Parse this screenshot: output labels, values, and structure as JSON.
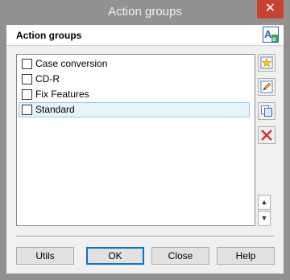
{
  "window": {
    "title": "Action groups",
    "close_glyph": "✕"
  },
  "header": {
    "label": "Action groups",
    "icon": "text-style-icon"
  },
  "list": {
    "items": [
      {
        "label": "Case conversion",
        "checked": false,
        "selected": false
      },
      {
        "label": "CD-R",
        "checked": false,
        "selected": false
      },
      {
        "label": "Fix Features",
        "checked": false,
        "selected": false
      },
      {
        "label": "Standard",
        "checked": false,
        "selected": true
      }
    ]
  },
  "side_buttons": [
    {
      "icon": "new-star-icon"
    },
    {
      "icon": "edit-pencil-icon"
    },
    {
      "icon": "copy-icon"
    },
    {
      "icon": "delete-x-icon"
    }
  ],
  "scroll_buttons": {
    "up_glyph": "▲",
    "down_glyph": "▼"
  },
  "buttons": {
    "utils": "Utils",
    "ok": "OK",
    "close": "Close",
    "help": "Help"
  },
  "colors": {
    "title_bar": "#929292",
    "close_button": "#c7432f",
    "selection_bg": "#e5f3fb",
    "selection_border": "#99c9ef",
    "default_button_border": "#0078d7",
    "delete_red": "#d22f2f"
  }
}
